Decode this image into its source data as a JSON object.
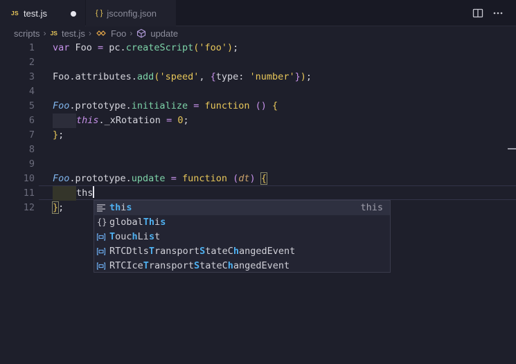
{
  "tabs": [
    {
      "badge": "JS",
      "label": "test.js",
      "dirty": true
    },
    {
      "badge": "{ }",
      "label": "jsconfig.json"
    }
  ],
  "breadcrumb": {
    "folder": "scripts",
    "file_badge": "JS",
    "file": "test.js",
    "class": "Foo",
    "method": "update"
  },
  "line_numbers": [
    "1",
    "2",
    "3",
    "4",
    "5",
    "6",
    "7",
    "8",
    "9",
    "10",
    "11",
    "12"
  ],
  "code": {
    "l1": {
      "kw": "var",
      "name": " Foo ",
      "eq": "=",
      "pc": " pc.",
      "fn": "createScript",
      "open": "(",
      "str": "'foo'",
      "close": ")",
      "end": ";"
    },
    "l3": {
      "pre": "Foo.attributes.",
      "fn": "add",
      "open": "(",
      "str": "'speed'",
      "comma": ", ",
      "ob": "{",
      "key": "type: ",
      "str2": "'number'",
      "cb": "}",
      "close": ")",
      "end": ";"
    },
    "l5": {
      "obj": "Foo",
      "mid": ".prototype.",
      "fn": "initialize",
      "eq": " = ",
      "kw": "function",
      "parens": " ()",
      "sp": " ",
      "ob": "{"
    },
    "l6": {
      "this": "this",
      "rest": "._xRotation ",
      "eq": "=",
      "sp": " ",
      "num": "0",
      "end": ";"
    },
    "l7": {
      "cb": "}",
      "end": ";"
    },
    "l10": {
      "obj": "Foo",
      "mid": ".prototype.",
      "fn": "update",
      "eq": " = ",
      "kw": "function",
      "sp": " ",
      "open": "(",
      "param": "dt",
      "close": ")",
      "sp2": " ",
      "ob": "{"
    },
    "l11": {
      "typed": "ths"
    },
    "l12": {
      "cb": "}",
      "end": ";"
    }
  },
  "suggestions": [
    {
      "icon": "keyword-icon",
      "label": "this",
      "detail": "this",
      "selected": true
    },
    {
      "icon": "namespace-icon",
      "label": "globalThis"
    },
    {
      "icon": "variable-icon",
      "label": "TouchList"
    },
    {
      "icon": "variable-icon",
      "label": "RTCDtlsTransportStateChangedEvent"
    },
    {
      "icon": "variable-icon",
      "label": "RTCIceTransportStateChangedEvent"
    }
  ],
  "colors": {
    "background": "#1e1f2b",
    "match_highlight": "#4fb0f0",
    "keyword": "#c792ea",
    "function": "#7dd3a8",
    "string": "#e8c75a"
  }
}
